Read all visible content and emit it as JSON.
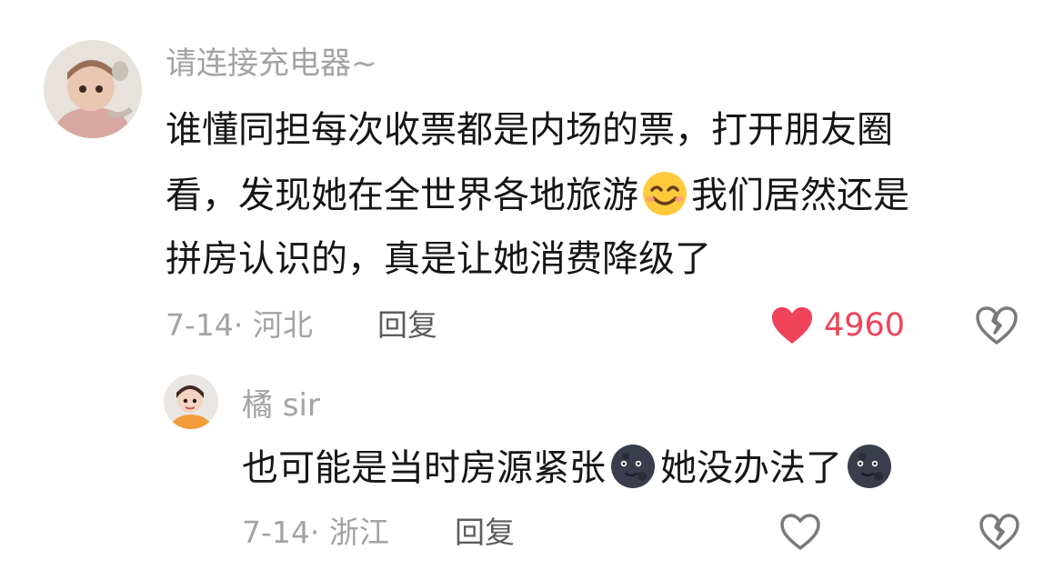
{
  "comment": {
    "username": "请连接充电器~",
    "lines": [
      "谁懂同担每次收票都是内场的票，打开朋友圈",
      "看，发现她在全世界各地旅游",
      "我们居然还是",
      "拼房认识的，真是让她消费降级了"
    ],
    "emoji": "smiling-face-emoji",
    "date_location": "7-14· 河北",
    "reply_label": "回复",
    "like_count": "4960",
    "liked": true,
    "like_color": "#f04259"
  },
  "reply": {
    "username": "橘 sir",
    "text_part1": "也可能是当时房源紧张",
    "text_part2": "她没办法了",
    "emoji": "new-moon-face-emoji",
    "date_location": "7-14· 浙江",
    "reply_label": "回复"
  }
}
